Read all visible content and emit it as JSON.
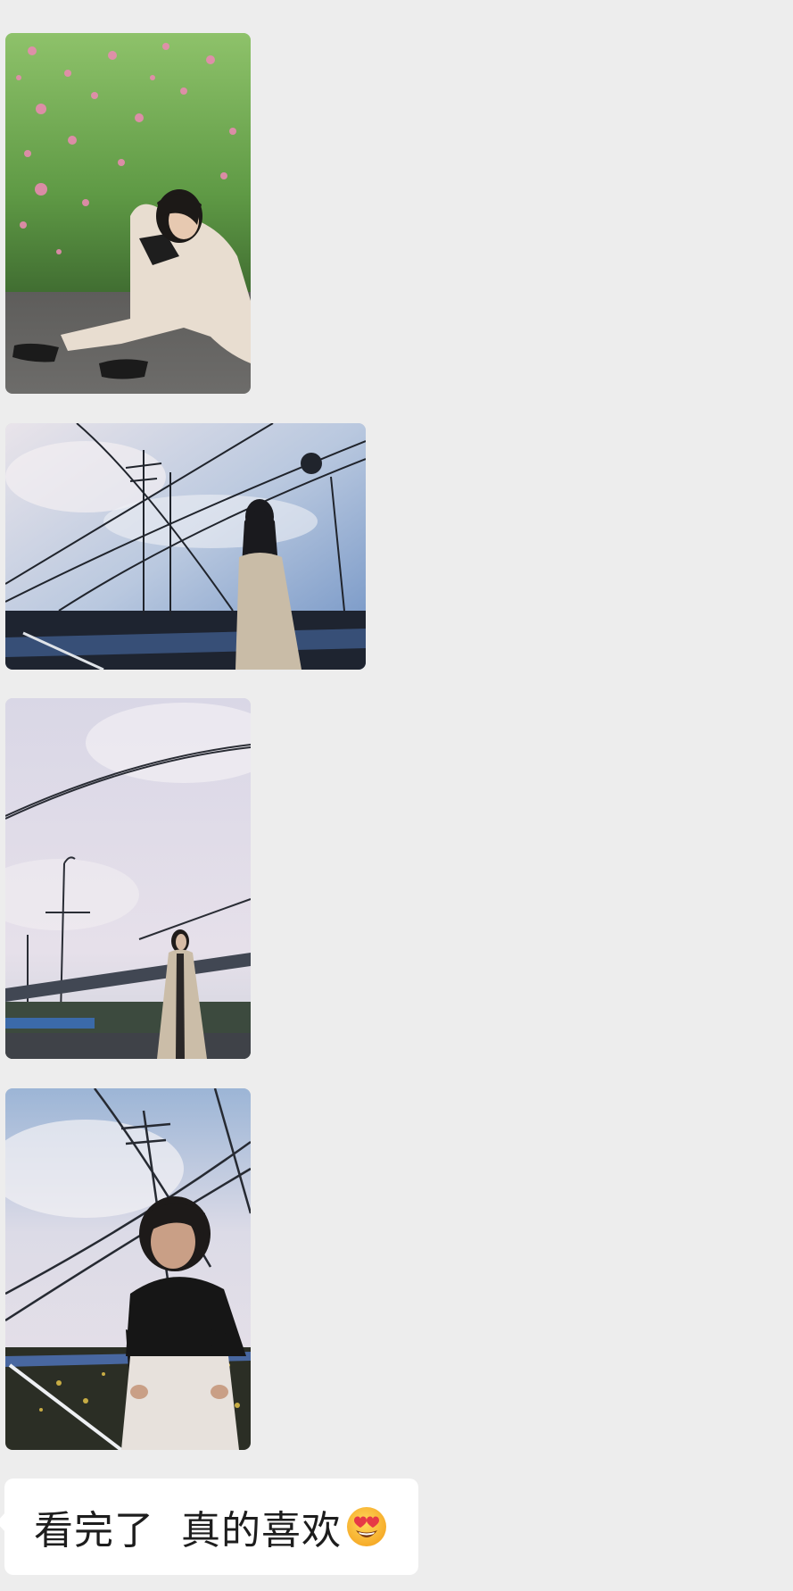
{
  "chat": {
    "messages": [
      {
        "type": "image",
        "content": "photo"
      },
      {
        "type": "image",
        "content": "photo"
      },
      {
        "type": "image",
        "content": "photo"
      },
      {
        "type": "image",
        "content": "photo"
      },
      {
        "type": "text",
        "text": "看完了  真的喜欢",
        "emoji": "heart-eyes-emoji-icon"
      }
    ]
  },
  "colors": {
    "background": "#ededed",
    "bubble": "#ffffff",
    "text": "#1d1d1d"
  }
}
